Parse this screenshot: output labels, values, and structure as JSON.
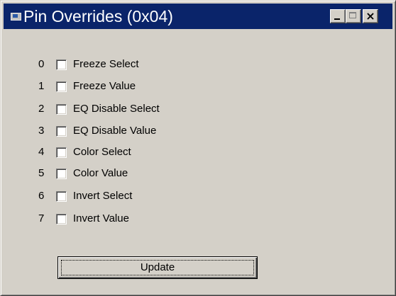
{
  "window": {
    "title": "Pin Overrides (0x04)",
    "icon": "app-window-icon",
    "controls": {
      "minimize": "minimize-icon",
      "maximize": "maximize-icon",
      "close": "close-icon",
      "close_glyph": "×"
    }
  },
  "pins": [
    {
      "number": "0",
      "label": "Freeze Select",
      "checked": false
    },
    {
      "number": "1",
      "label": "Freeze Value",
      "checked": false
    },
    {
      "number": "2",
      "label": "EQ Disable Select",
      "checked": false
    },
    {
      "number": "3",
      "label": "EQ Disable Value",
      "checked": false
    },
    {
      "number": "4",
      "label": "Color Select",
      "checked": false
    },
    {
      "number": "5",
      "label": "Color Value",
      "checked": false
    },
    {
      "number": "6",
      "label": "Invert Select",
      "checked": false
    },
    {
      "number": "7",
      "label": "Invert Value",
      "checked": false
    }
  ],
  "actions": {
    "update_label": "Update"
  },
  "colors": {
    "titlebar": "#0a246a",
    "face": "#d4d0c8",
    "title_text": "#ffffff"
  }
}
